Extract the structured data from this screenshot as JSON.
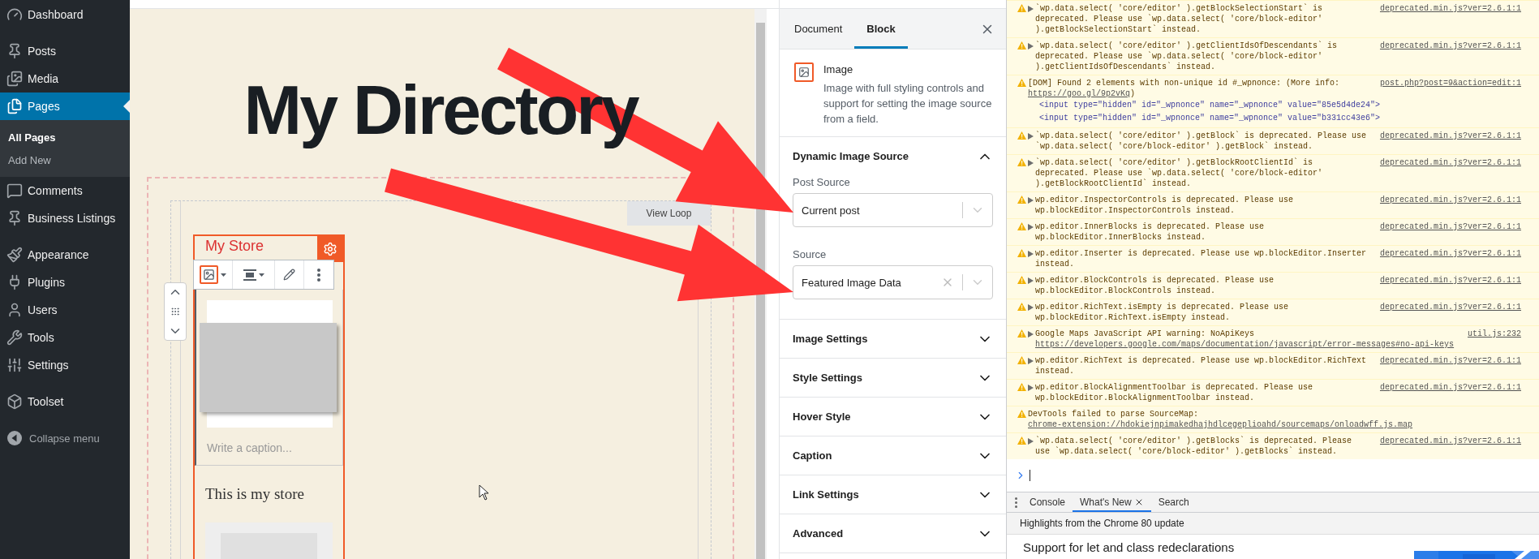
{
  "sidebar": {
    "groups": [
      {
        "items": [
          {
            "label": "Dashboard",
            "selected": false
          }
        ]
      },
      {
        "items": [
          {
            "label": "Posts",
            "selected": false
          },
          {
            "label": "Media",
            "selected": false
          },
          {
            "label": "Pages",
            "selected": true,
            "children": [
              {
                "label": "All Pages",
                "selected": true
              },
              {
                "label": "Add New",
                "selected": false
              }
            ]
          },
          {
            "label": "Comments",
            "selected": false
          },
          {
            "label": "Business Listings",
            "selected": false
          }
        ]
      },
      {
        "items": [
          {
            "label": "Appearance",
            "selected": false
          },
          {
            "label": "Plugins",
            "selected": false
          },
          {
            "label": "Users",
            "selected": false
          },
          {
            "label": "Tools",
            "selected": false
          },
          {
            "label": "Settings",
            "selected": false
          }
        ]
      },
      {
        "items": [
          {
            "label": "Toolset",
            "selected": false
          }
        ]
      }
    ],
    "collapse": "Collapse menu"
  },
  "editor": {
    "title": "My Directory",
    "view_loop_button": "View Loop",
    "card": {
      "title": "My Store",
      "caption_placeholder": "Write a caption...",
      "body": "This is my store"
    }
  },
  "inspector": {
    "tabs": [
      {
        "label": "Document",
        "selected": false
      },
      {
        "label": "Block",
        "selected": true
      }
    ],
    "block": {
      "name": "Image",
      "description": "Image with full styling controls and support for setting the image source from a field."
    },
    "panels": [
      {
        "title": "Dynamic Image Source",
        "expanded": true,
        "fields": [
          {
            "label": "Post Source",
            "value": "Current post",
            "clearable": false
          },
          {
            "label": "Source",
            "value": "Featured Image Data",
            "clearable": true
          }
        ]
      },
      {
        "title": "Image Settings",
        "expanded": false
      },
      {
        "title": "Style Settings",
        "expanded": false
      },
      {
        "title": "Hover Style",
        "expanded": false
      },
      {
        "title": "Caption",
        "expanded": false
      },
      {
        "title": "Link Settings",
        "expanded": false
      },
      {
        "title": "Advanced",
        "expanded": false
      }
    ]
  },
  "console": {
    "messages": [
      {
        "expandable": true,
        "text": "`wp.data.select( 'core/editor' ).getBlockSelectionStart` is deprecated. Please use `wp.data.select( 'core/block-editor' ).getBlockSelectionStart` instead.",
        "source": "deprecated.min.js?ver=2.6.1:1"
      },
      {
        "expandable": true,
        "text": "`wp.data.select( 'core/editor' ).getClientIdsOfDescendants` is deprecated. Please use `wp.data.select( 'core/block-editor' ).getClientIdsOfDescendants` instead.",
        "source": "deprecated.min.js?ver=2.6.1:1"
      },
      {
        "expandable": false,
        "text": "[DOM] Found 2 elements with non-unique id #_wpnonce: (More info: ",
        "link": "https://goo.gl/9p2vKq",
        "after": ")",
        "source": "post.php?post=9&action=edit:1",
        "details": [
          "<input type=\"hidden\" id=\"_wpnonce\" name=\"_wpnonce\" value=\"85e5d4de24\">",
          "<input type=\"hidden\" id=\"_wpnonce\" name=\"_wpnonce\" value=\"b331cc43e6\">"
        ]
      },
      {
        "expandable": true,
        "text": "`wp.data.select( 'core/editor' ).getBlock` is deprecated. Please use `wp.data.select( 'core/block-editor' ).getBlock` instead.",
        "source": "deprecated.min.js?ver=2.6.1:1"
      },
      {
        "expandable": true,
        "text": "`wp.data.select( 'core/editor' ).getBlockRootClientId` is deprecated. Please use `wp.data.select( 'core/block-editor' ).getBlockRootClientId` instead.",
        "source": "deprecated.min.js?ver=2.6.1:1"
      },
      {
        "expandable": true,
        "text": "wp.editor.InspectorControls is deprecated. Please use wp.blockEditor.InspectorControls instead.",
        "source": "deprecated.min.js?ver=2.6.1:1"
      },
      {
        "expandable": true,
        "text": "wp.editor.InnerBlocks is deprecated. Please use wp.blockEditor.InnerBlocks instead.",
        "source": "deprecated.min.js?ver=2.6.1:1"
      },
      {
        "expandable": true,
        "text": "wp.editor.Inserter is deprecated. Please use wp.blockEditor.Inserter instead.",
        "source": "deprecated.min.js?ver=2.6.1:1"
      },
      {
        "expandable": true,
        "text": "wp.editor.BlockControls is deprecated. Please use wp.blockEditor.BlockControls instead.",
        "source": "deprecated.min.js?ver=2.6.1:1"
      },
      {
        "expandable": true,
        "text": "wp.editor.RichText.isEmpty is deprecated. Please use wp.blockEditor.RichText.isEmpty instead.",
        "source": "deprecated.min.js?ver=2.6.1:1"
      },
      {
        "expandable": true,
        "text": "Google Maps JavaScript API warning: NoApiKeys ",
        "link": "https://developers.google.com/maps/documentation/javascript/error-messages#no-api-keys",
        "source": "util.js:232"
      },
      {
        "expandable": true,
        "text": "wp.editor.RichText is deprecated. Please use wp.blockEditor.RichText instead.",
        "source": "deprecated.min.js?ver=2.6.1:1"
      },
      {
        "expandable": true,
        "text": "wp.editor.BlockAlignmentToolbar is deprecated. Please use wp.blockEditor.BlockAlignmentToolbar instead.",
        "source": "deprecated.min.js?ver=2.6.1:1"
      },
      {
        "expandable": false,
        "text": "DevTools failed to parse SourceMap: ",
        "link": "chrome-extension://hdokiejnpimakedhajhdlcegeplioahd/sourcemaps/onloadwff.js.map"
      },
      {
        "expandable": true,
        "text": "`wp.data.select( 'core/editor' ).getBlocks` is deprecated. Please use `wp.data.select( 'core/block-editor' ).getBlocks` instead.",
        "source": "deprecated.min.js?ver=2.6.1:1"
      }
    ],
    "drawer": {
      "tabs": [
        {
          "label": "Console",
          "selected": false,
          "closable": false
        },
        {
          "label": "What's New",
          "selected": true,
          "closable": true
        },
        {
          "label": "Search",
          "selected": false,
          "closable": false
        }
      ],
      "heading": "Highlights from the Chrome 80 update",
      "article_title": "Support for let and class redeclarations"
    }
  }
}
